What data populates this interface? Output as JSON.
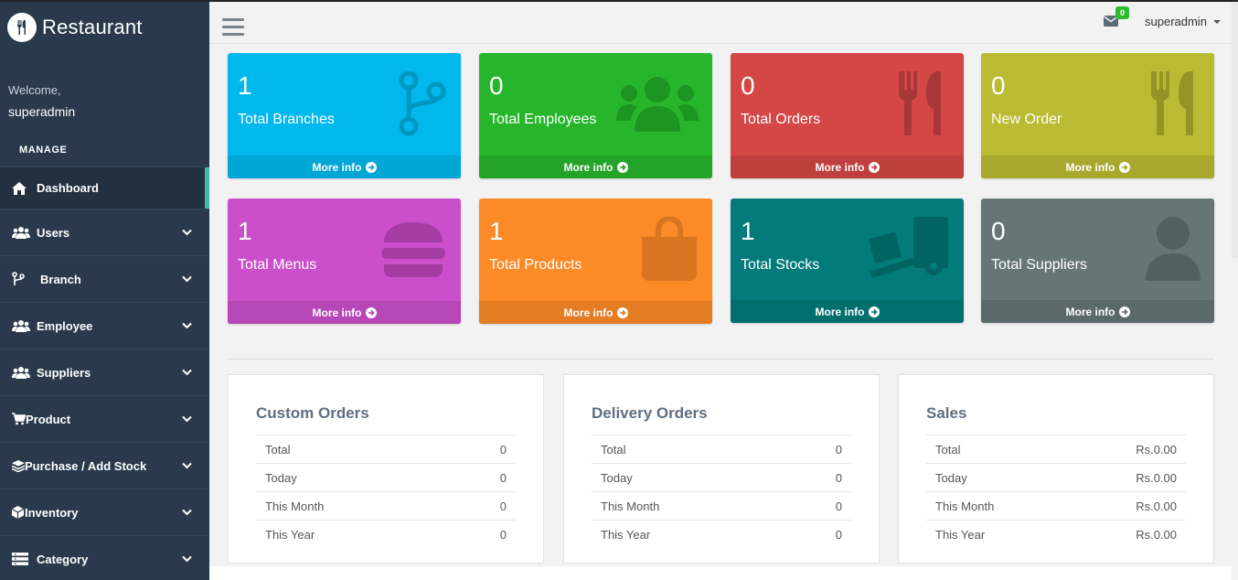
{
  "brand": {
    "name": "Restaurant"
  },
  "sidebar": {
    "welcome": "Welcome,",
    "username": "superadmin",
    "section": "MANAGE",
    "items": [
      {
        "label": "Dashboard",
        "icon": "home-icon",
        "active": true
      },
      {
        "label": "Users",
        "icon": "users-icon"
      },
      {
        "label": "Branch",
        "icon": "branch-icon"
      },
      {
        "label": "Employee",
        "icon": "users-icon"
      },
      {
        "label": "Suppliers",
        "icon": "users-icon"
      },
      {
        "label": "Product",
        "icon": "cart-icon"
      },
      {
        "label": "Purchase / Add Stock",
        "icon": "layers-icon"
      },
      {
        "label": "Inventory",
        "icon": "cube-icon"
      },
      {
        "label": "Category",
        "icon": "list-icon"
      }
    ]
  },
  "header": {
    "mail_count": "0",
    "user": "superadmin"
  },
  "boxes": [
    {
      "value": "1",
      "label": "Total Branches",
      "more": "More info",
      "color": "#00b8ec",
      "footer": "#00a6d5",
      "icon": "code-branch-icon"
    },
    {
      "value": "0",
      "label": "Total Employees",
      "more": "More info",
      "color": "#27b62b",
      "footer": "#23a327",
      "icon": "users-icon"
    },
    {
      "value": "0",
      "label": "Total Orders",
      "more": "More info",
      "color": "#d54646",
      "footer": "#bf3f3f",
      "icon": "utensils-icon"
    },
    {
      "value": "0",
      "label": "New Order",
      "more": "More info",
      "color": "#bbbb33",
      "footer": "#a8a82e",
      "icon": "utensils-icon"
    },
    {
      "value": "1",
      "label": "Total Menus",
      "more": "More info",
      "color": "#cb4fcb",
      "footer": "#b647b6",
      "icon": "hamburger-icon"
    },
    {
      "value": "1",
      "label": "Total Products",
      "more": "More info",
      "color": "#fb8a27",
      "footer": "#e37c23",
      "icon": "shopping-bag-icon"
    },
    {
      "value": "1",
      "label": "Total Stocks",
      "more": "More info",
      "color": "#037b7b",
      "footer": "#036e6e",
      "icon": "dolly-icon"
    },
    {
      "value": "0",
      "label": "Total Suppliers",
      "more": "More info",
      "color": "#677577",
      "footer": "#5c696b",
      "icon": "user-icon"
    }
  ],
  "panels": [
    {
      "title": "Custom Orders",
      "rows": [
        {
          "label": "Total",
          "value": "0"
        },
        {
          "label": "Today",
          "value": "0"
        },
        {
          "label": "This Month",
          "value": "0"
        },
        {
          "label": "This Year",
          "value": "0"
        }
      ]
    },
    {
      "title": "Delivery Orders",
      "rows": [
        {
          "label": "Total",
          "value": "0"
        },
        {
          "label": "Today",
          "value": "0"
        },
        {
          "label": "This Month",
          "value": "0"
        },
        {
          "label": "This Year",
          "value": "0"
        }
      ]
    },
    {
      "title": "Sales",
      "rows": [
        {
          "label": "Total",
          "value": "Rs.0.00"
        },
        {
          "label": "Today",
          "value": "Rs.0.00"
        },
        {
          "label": "This Month",
          "value": "Rs.0.00"
        },
        {
          "label": "This Year",
          "value": "Rs.0.00"
        }
      ]
    }
  ]
}
